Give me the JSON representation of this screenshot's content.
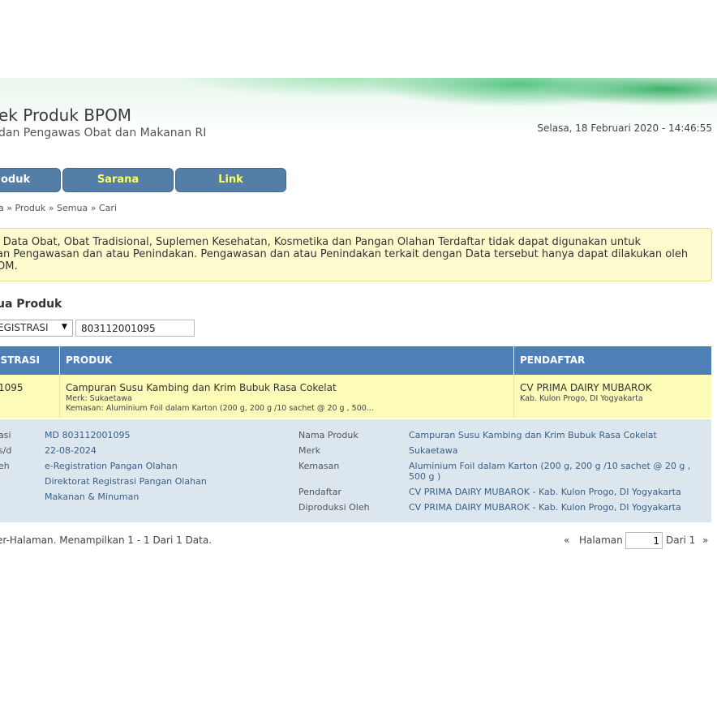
{
  "header": {
    "title": "ek Produk BPOM",
    "subtitle": "dan Pengawas Obat dan Makanan RI",
    "datetime": "Selasa, 18 Februari 2020 - 14:46:55"
  },
  "nav": {
    "items": [
      {
        "label": "oduk"
      },
      {
        "label": "Sarana"
      },
      {
        "label": "Link"
      }
    ]
  },
  "breadcrumb": {
    "items": [
      "a",
      "Produk",
      "Semua",
      "Cari"
    ],
    "separator": "»"
  },
  "notice": {
    "lines": [
      "i Data Obat, Obat Tradisional, Suplemen Kesehatan, Kosmetika dan Pangan Olahan Terdaftar tidak dapat digunakan untuk",
      "an Pengawasan dan atau Penindakan. Pengawasan dan atau Penindakan terkait dengan Data tersebut hanya dapat dilakukan oleh",
      "OM."
    ]
  },
  "section_title": "ua Produk",
  "search": {
    "select_value": "EGISTRASI",
    "input_value": "803112001095"
  },
  "table": {
    "headers": [
      "ISTRASI",
      "PRODUK",
      "PENDAFTAR"
    ],
    "rows": [
      {
        "registrasi": "1095",
        "produk_name": "Campuran Susu Kambing dan Krim Bubuk Rasa Cokelat",
        "merk": "Merk: Sukaetawa",
        "kemasan": "Kemasan: Aluminium Foil dalam Karton (200 g, 200 g /10 sachet @ 20 g , 500...",
        "pendaftar": "CV PRIMA DAIRY MUBAROK",
        "lokasi": "Kab. Kulon Progo, DI Yogyakarta"
      }
    ]
  },
  "detail": {
    "left_labels": [
      "asi",
      "s/d",
      "eh"
    ],
    "left_values": [
      "MD 803112001095",
      "22-08-2024",
      "e-Registration Pangan Olahan",
      "Direktorat Registrasi Pangan Olahan",
      "Makanan & Minuman"
    ],
    "right_labels": [
      "Nama Produk",
      "Merk",
      "Kemasan",
      "Pendaftar",
      "Diproduksi Oleh"
    ],
    "right_values": [
      "Campuran Susu Kambing dan Krim Bubuk Rasa Cokelat",
      "Sukaetawa",
      "Aluminium Foil dalam Karton (200 g, 200 g /10 sachet @ 20 g ,",
      "500 g )",
      "CV PRIMA DAIRY MUBAROK - Kab. Kulon Progo, DI Yogyakarta",
      "CV PRIMA DAIRY MUBAROK - Kab. Kulon Progo, DI Yogyakarta"
    ]
  },
  "pagination": {
    "info": "er-Halaman. Menampilkan 1 - 1 Dari 1 Data.",
    "prev": "«",
    "label": "Halaman",
    "page": "1",
    "of": "Dari 1",
    "next": "»"
  },
  "colors": {
    "nav_bg": "#557ea6",
    "nav_accent_text": "#ffff66",
    "table_header": "#4f7fb8",
    "row_highlight": "#fdfbb8",
    "detail_bg": "#dce6ee",
    "notice_bg": "#fdfbce"
  }
}
